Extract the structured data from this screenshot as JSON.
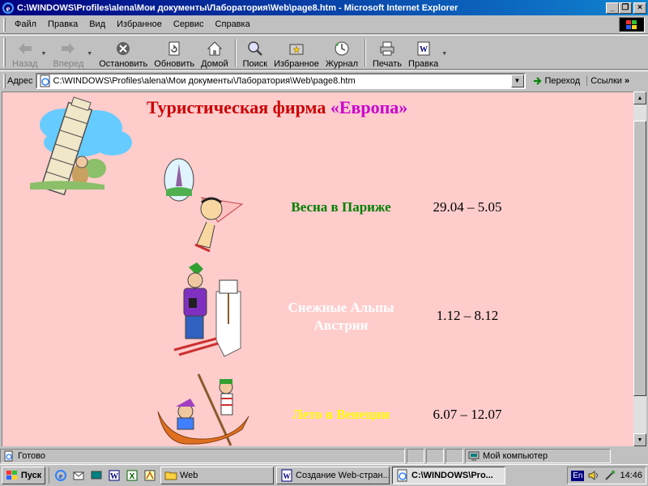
{
  "window": {
    "title": "C:\\WINDOWS\\Profiles\\alena\\Мои документы\\Лаборатория\\Web\\page8.htm - Microsoft Internet Explorer",
    "minimize": "_",
    "maximize": "1",
    "close": "×"
  },
  "menu": {
    "items": [
      "Файл",
      "Правка",
      "Вид",
      "Избранное",
      "Сервис",
      "Справка"
    ]
  },
  "toolbar": {
    "back": "Назад",
    "forward": "Вперед",
    "stop": "Остановить",
    "refresh": "Обновить",
    "home": "Домой",
    "search": "Поиск",
    "favorites": "Избранное",
    "history": "Журнал",
    "print": "Печать",
    "edit": "Правка"
  },
  "address": {
    "label": "Адрес",
    "value": "C:\\WINDOWS\\Profiles\\alena\\Мои документы\\Лаборатория\\Web\\page8.htm",
    "go": "Переход",
    "links": "Ссылки"
  },
  "page": {
    "heading_main": "Туристическая фирма ",
    "heading_accent": "«Европа»",
    "tours": [
      {
        "name": "Весна в Париже",
        "dates": "29.04 – 5.05",
        "color": "#008000"
      },
      {
        "name": "Снежные Альпы Австрии",
        "dates": "1.12 – 8.12",
        "color": "#ffffff"
      },
      {
        "name": "Лето в Венеции",
        "dates": "6.07 – 12.07",
        "color": "#ffff00"
      }
    ],
    "background": "#ffcccc"
  },
  "status": {
    "text": "Готово",
    "zone": "Мой компьютер"
  },
  "taskbar": {
    "start": "Пуск",
    "tasks": [
      "Web",
      "Создание Web-стран...",
      "C:\\WINDOWS\\Pro..."
    ],
    "lang": "En",
    "clock": "14:46"
  }
}
